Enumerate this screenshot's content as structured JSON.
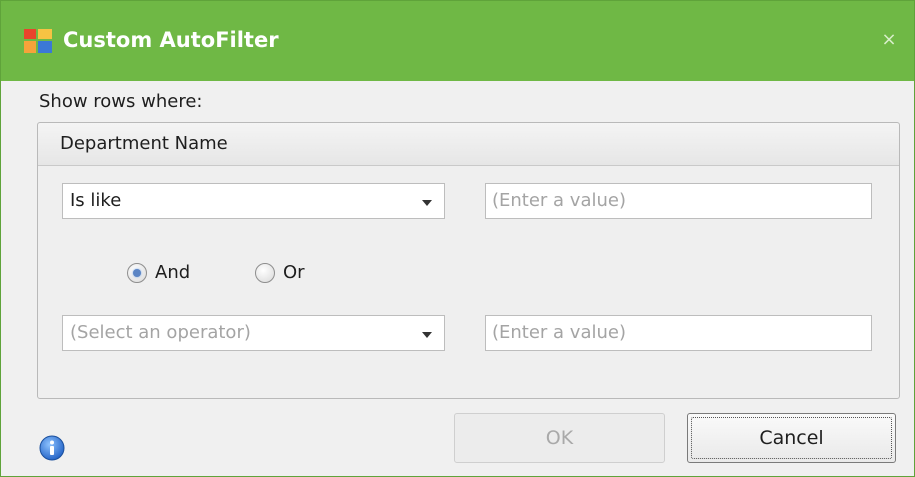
{
  "window": {
    "title": "Custom AutoFilter",
    "close_glyph": "×",
    "accent_color": "#6fb845"
  },
  "filter": {
    "show_rows_label": "Show rows where:",
    "column_name": "Department Name",
    "condition1": {
      "operator": "Is like",
      "value_placeholder": "(Enter a value)"
    },
    "logic": {
      "and_label": "And",
      "or_label": "Or",
      "selected": "And"
    },
    "condition2": {
      "operator_placeholder": "(Select an operator)",
      "value_placeholder": "(Enter a value)"
    }
  },
  "buttons": {
    "ok_label": "OK",
    "ok_enabled": false,
    "cancel_label": "Cancel"
  },
  "icons": {
    "app": "app-grid-icon",
    "close": "close-icon",
    "dropdown": "chevron-down-icon",
    "info": "info-icon"
  }
}
